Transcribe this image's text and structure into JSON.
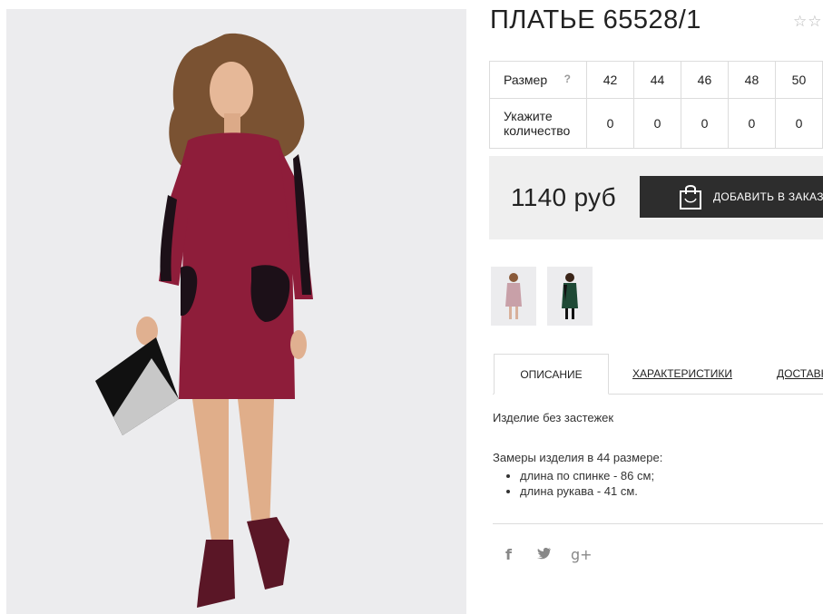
{
  "product": {
    "title": "ПЛАТЬЕ 65528/1",
    "rating_icons": [
      "star-empty",
      "star-empty"
    ]
  },
  "size_table": {
    "size_label": "Размер",
    "help_symbol": "?",
    "sizes": [
      "42",
      "44",
      "46",
      "48",
      "50"
    ],
    "quantity_label": "Укажите количество",
    "quantities": [
      "0",
      "0",
      "0",
      "0",
      "0"
    ]
  },
  "purchase": {
    "price": "1140 руб",
    "add_button_label": "ДОБАВИТЬ В ЗАКАЗ",
    "button_icon": "shopping-bag-icon"
  },
  "thumbnails": [
    {
      "name": "thumbnail-burgundy-dress",
      "color": "#c8a0a8"
    },
    {
      "name": "thumbnail-green-dress",
      "color": "#1f4a36"
    }
  ],
  "tabs": [
    {
      "label": "ОПИСАНИЕ",
      "active": true
    },
    {
      "label": "ХАРАКТЕРИСТИКИ",
      "active": false
    },
    {
      "label": "ДОСТАВКА",
      "active": false
    }
  ],
  "description": {
    "line1": "Изделие без застежек",
    "measures_title": "Замеры изделия в 44 размере:",
    "measures": [
      "длина по спинке - 86 см;",
      "длина рукава - 41 см."
    ]
  },
  "social": {
    "facebook": "f",
    "twitter": "🐦",
    "google": "g+"
  },
  "colors": {
    "dress": "#8e1d3a",
    "button_bg": "#2d2d2d",
    "price_box_bg": "#efefef",
    "photo_bg": "#ececee"
  }
}
